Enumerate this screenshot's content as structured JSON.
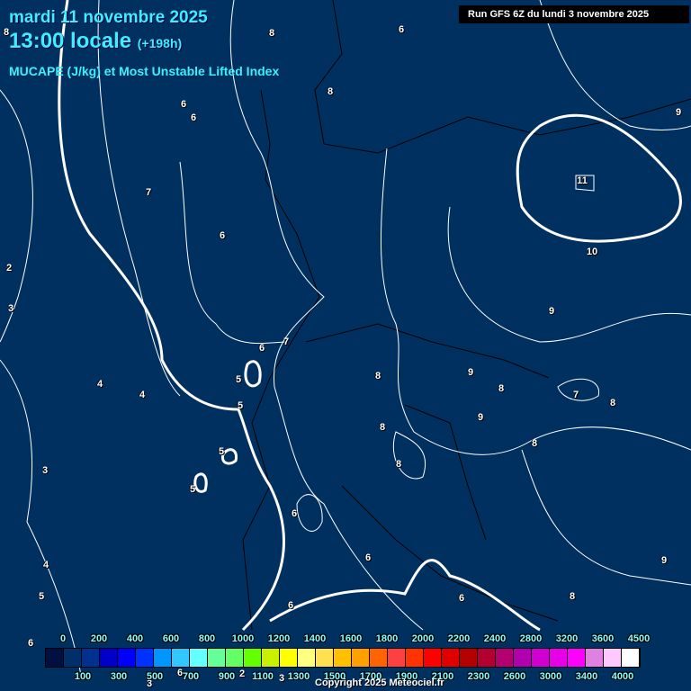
{
  "header": {
    "date": "mardi 11 novembre 2025",
    "time": "13:00 locale",
    "lead": "(+198h)",
    "parameter": "MUCAPE (J/kg) et Most Unstable Lifted Index",
    "run": "Run GFS 6Z du lundi 3 novembre 2025"
  },
  "legend": {
    "colors": [
      "#001040",
      "#00306a",
      "#003090",
      "#0000c8",
      "#0000ff",
      "#0032ff",
      "#0096ff",
      "#32c8ff",
      "#64ffff",
      "#64ff96",
      "#64ff64",
      "#64ff00",
      "#c8f000",
      "#ffff00",
      "#ffff80",
      "#ffe050",
      "#ffc000",
      "#ffa000",
      "#ff6400",
      "#ff4040",
      "#ff3200",
      "#ff0000",
      "#e00000",
      "#b40000",
      "#b40030",
      "#b40070",
      "#b000b0",
      "#d000d0",
      "#e800e8",
      "#ff00ff",
      "#e080e0",
      "#ffc8ff",
      "#ffffff"
    ],
    "top_labels": [
      "0",
      "200",
      "400",
      "600",
      "800",
      "1000",
      "1200",
      "1400",
      "1600",
      "1800",
      "2000",
      "2200",
      "2400",
      "2800",
      "3200",
      "3600",
      "4500"
    ],
    "bottom_labels": [
      "100",
      "300",
      "500",
      "700",
      "900",
      "1100",
      "1300",
      "1500",
      "1700",
      "1900",
      "2100",
      "2300",
      "2600",
      "3000",
      "3400",
      "4000"
    ]
  },
  "contour_labels": [
    "8",
    "6",
    "8",
    "6",
    "6",
    "7",
    "6",
    "2",
    "3",
    "6",
    "7",
    "5",
    "5",
    "4",
    "4",
    "5",
    "5",
    "3",
    "6",
    "8",
    "9",
    "8",
    "9",
    "8",
    "8",
    "9",
    "11",
    "10",
    "9",
    "8",
    "7",
    "8",
    "8",
    "4",
    "5",
    "6",
    "6",
    "6",
    "6",
    "8",
    "9",
    "2",
    "3",
    "3",
    "6"
  ],
  "copyright": "Copyright 2025 Meteociel.fr"
}
